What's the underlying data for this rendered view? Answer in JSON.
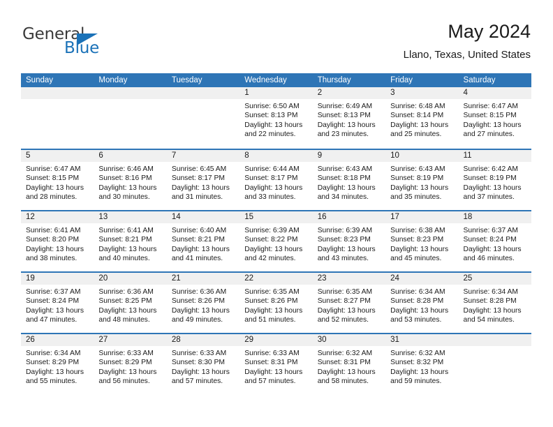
{
  "brand": {
    "name_top": "General",
    "name_bottom": "Blue",
    "triangle_icon": "triangle-icon",
    "accent_color": "#1b72b8"
  },
  "header": {
    "title": "May 2024",
    "subtitle": "Llano, Texas, United States"
  },
  "calendar": {
    "header_bg": "#2e75b6",
    "day_band_bg": "#f0f0f0",
    "weekdays": [
      "Sunday",
      "Monday",
      "Tuesday",
      "Wednesday",
      "Thursday",
      "Friday",
      "Saturday"
    ],
    "weeks": [
      [
        {
          "day": "",
          "lines": []
        },
        {
          "day": "",
          "lines": []
        },
        {
          "day": "",
          "lines": []
        },
        {
          "day": "1",
          "lines": [
            "Sunrise: 6:50 AM",
            "Sunset: 8:13 PM",
            "Daylight: 13 hours",
            "and 22 minutes."
          ]
        },
        {
          "day": "2",
          "lines": [
            "Sunrise: 6:49 AM",
            "Sunset: 8:13 PM",
            "Daylight: 13 hours",
            "and 23 minutes."
          ]
        },
        {
          "day": "3",
          "lines": [
            "Sunrise: 6:48 AM",
            "Sunset: 8:14 PM",
            "Daylight: 13 hours",
            "and 25 minutes."
          ]
        },
        {
          "day": "4",
          "lines": [
            "Sunrise: 6:47 AM",
            "Sunset: 8:15 PM",
            "Daylight: 13 hours",
            "and 27 minutes."
          ]
        }
      ],
      [
        {
          "day": "5",
          "lines": [
            "Sunrise: 6:47 AM",
            "Sunset: 8:15 PM",
            "Daylight: 13 hours",
            "and 28 minutes."
          ]
        },
        {
          "day": "6",
          "lines": [
            "Sunrise: 6:46 AM",
            "Sunset: 8:16 PM",
            "Daylight: 13 hours",
            "and 30 minutes."
          ]
        },
        {
          "day": "7",
          "lines": [
            "Sunrise: 6:45 AM",
            "Sunset: 8:17 PM",
            "Daylight: 13 hours",
            "and 31 minutes."
          ]
        },
        {
          "day": "8",
          "lines": [
            "Sunrise: 6:44 AM",
            "Sunset: 8:17 PM",
            "Daylight: 13 hours",
            "and 33 minutes."
          ]
        },
        {
          "day": "9",
          "lines": [
            "Sunrise: 6:43 AM",
            "Sunset: 8:18 PM",
            "Daylight: 13 hours",
            "and 34 minutes."
          ]
        },
        {
          "day": "10",
          "lines": [
            "Sunrise: 6:43 AM",
            "Sunset: 8:19 PM",
            "Daylight: 13 hours",
            "and 35 minutes."
          ]
        },
        {
          "day": "11",
          "lines": [
            "Sunrise: 6:42 AM",
            "Sunset: 8:19 PM",
            "Daylight: 13 hours",
            "and 37 minutes."
          ]
        }
      ],
      [
        {
          "day": "12",
          "lines": [
            "Sunrise: 6:41 AM",
            "Sunset: 8:20 PM",
            "Daylight: 13 hours",
            "and 38 minutes."
          ]
        },
        {
          "day": "13",
          "lines": [
            "Sunrise: 6:41 AM",
            "Sunset: 8:21 PM",
            "Daylight: 13 hours",
            "and 40 minutes."
          ]
        },
        {
          "day": "14",
          "lines": [
            "Sunrise: 6:40 AM",
            "Sunset: 8:21 PM",
            "Daylight: 13 hours",
            "and 41 minutes."
          ]
        },
        {
          "day": "15",
          "lines": [
            "Sunrise: 6:39 AM",
            "Sunset: 8:22 PM",
            "Daylight: 13 hours",
            "and 42 minutes."
          ]
        },
        {
          "day": "16",
          "lines": [
            "Sunrise: 6:39 AM",
            "Sunset: 8:23 PM",
            "Daylight: 13 hours",
            "and 43 minutes."
          ]
        },
        {
          "day": "17",
          "lines": [
            "Sunrise: 6:38 AM",
            "Sunset: 8:23 PM",
            "Daylight: 13 hours",
            "and 45 minutes."
          ]
        },
        {
          "day": "18",
          "lines": [
            "Sunrise: 6:37 AM",
            "Sunset: 8:24 PM",
            "Daylight: 13 hours",
            "and 46 minutes."
          ]
        }
      ],
      [
        {
          "day": "19",
          "lines": [
            "Sunrise: 6:37 AM",
            "Sunset: 8:24 PM",
            "Daylight: 13 hours",
            "and 47 minutes."
          ]
        },
        {
          "day": "20",
          "lines": [
            "Sunrise: 6:36 AM",
            "Sunset: 8:25 PM",
            "Daylight: 13 hours",
            "and 48 minutes."
          ]
        },
        {
          "day": "21",
          "lines": [
            "Sunrise: 6:36 AM",
            "Sunset: 8:26 PM",
            "Daylight: 13 hours",
            "and 49 minutes."
          ]
        },
        {
          "day": "22",
          "lines": [
            "Sunrise: 6:35 AM",
            "Sunset: 8:26 PM",
            "Daylight: 13 hours",
            "and 51 minutes."
          ]
        },
        {
          "day": "23",
          "lines": [
            "Sunrise: 6:35 AM",
            "Sunset: 8:27 PM",
            "Daylight: 13 hours",
            "and 52 minutes."
          ]
        },
        {
          "day": "24",
          "lines": [
            "Sunrise: 6:34 AM",
            "Sunset: 8:28 PM",
            "Daylight: 13 hours",
            "and 53 minutes."
          ]
        },
        {
          "day": "25",
          "lines": [
            "Sunrise: 6:34 AM",
            "Sunset: 8:28 PM",
            "Daylight: 13 hours",
            "and 54 minutes."
          ]
        }
      ],
      [
        {
          "day": "26",
          "lines": [
            "Sunrise: 6:34 AM",
            "Sunset: 8:29 PM",
            "Daylight: 13 hours",
            "and 55 minutes."
          ]
        },
        {
          "day": "27",
          "lines": [
            "Sunrise: 6:33 AM",
            "Sunset: 8:29 PM",
            "Daylight: 13 hours",
            "and 56 minutes."
          ]
        },
        {
          "day": "28",
          "lines": [
            "Sunrise: 6:33 AM",
            "Sunset: 8:30 PM",
            "Daylight: 13 hours",
            "and 57 minutes."
          ]
        },
        {
          "day": "29",
          "lines": [
            "Sunrise: 6:33 AM",
            "Sunset: 8:31 PM",
            "Daylight: 13 hours",
            "and 57 minutes."
          ]
        },
        {
          "day": "30",
          "lines": [
            "Sunrise: 6:32 AM",
            "Sunset: 8:31 PM",
            "Daylight: 13 hours",
            "and 58 minutes."
          ]
        },
        {
          "day": "31",
          "lines": [
            "Sunrise: 6:32 AM",
            "Sunset: 8:32 PM",
            "Daylight: 13 hours",
            "and 59 minutes."
          ]
        },
        {
          "day": "",
          "lines": []
        }
      ]
    ]
  }
}
